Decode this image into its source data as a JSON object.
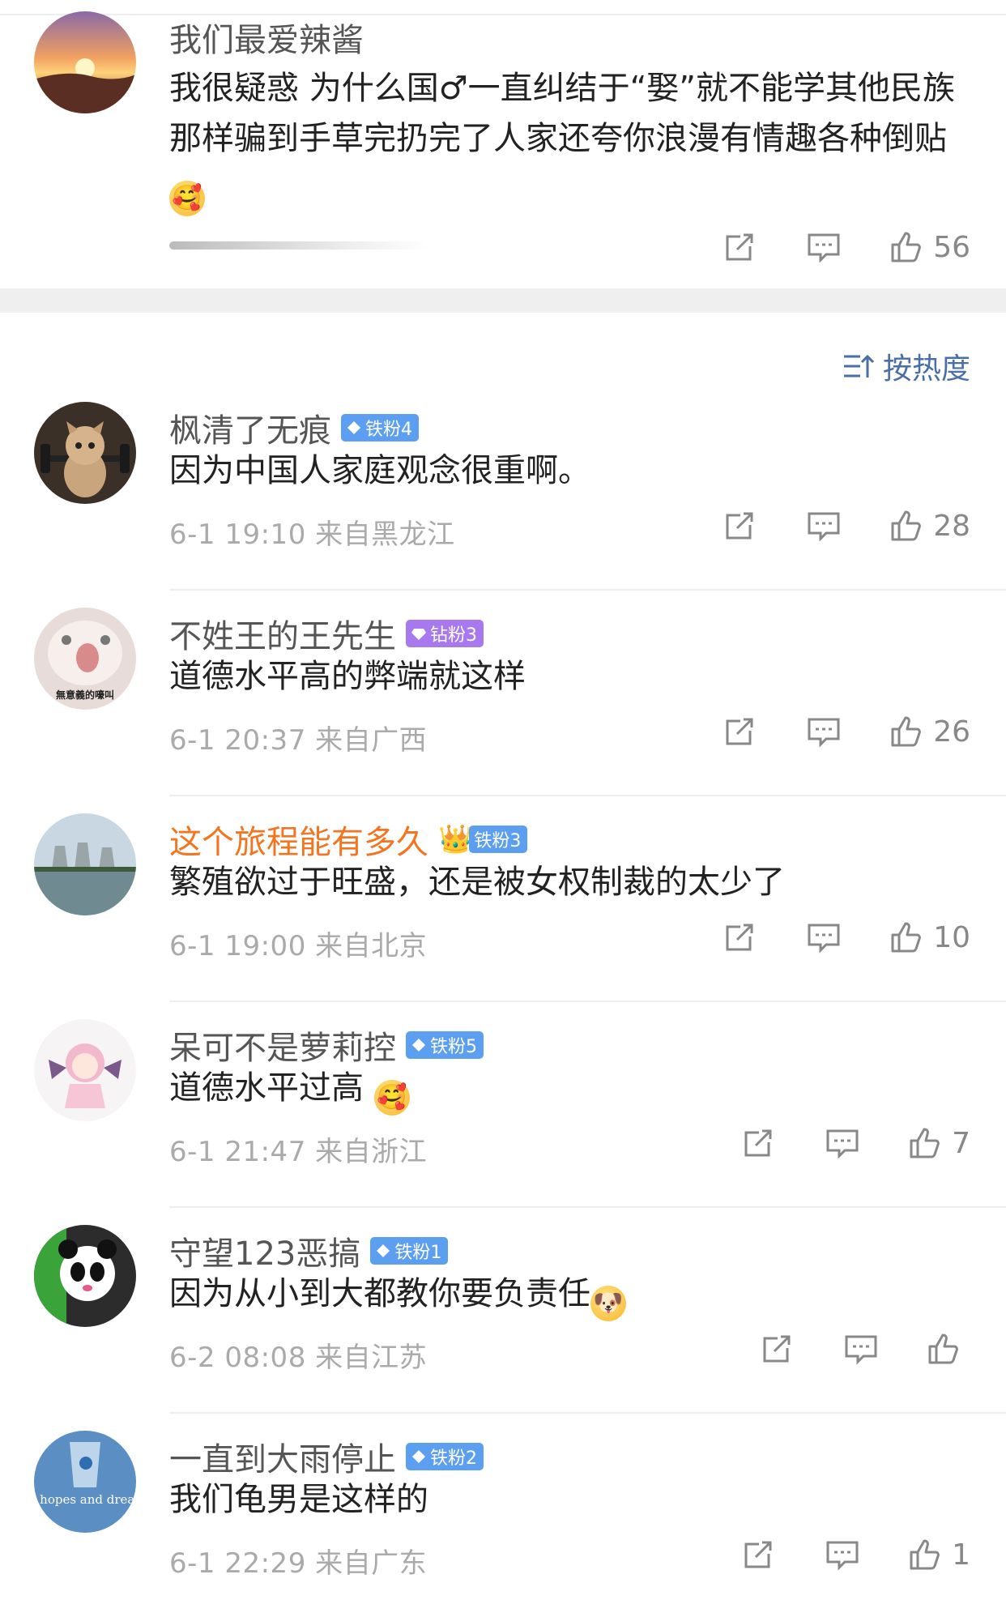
{
  "top_comment": {
    "username": "我们最爱辣酱",
    "text": "我很疑惑 为什么国♂一直纠结于“娶”就不能学其他民族那样骗到手草完扔完了人家还夸你浪漫有情趣各种倒贴",
    "emoji": "🥰",
    "likes": "56",
    "avatar_icon": "sunset-avatar"
  },
  "sort": {
    "label": "按热度"
  },
  "colors": {
    "accent_blue": "#4a6ea8",
    "name_orange": "#f47420",
    "badge_blue": "#5c9ff0",
    "badge_purple": "#a879ee"
  },
  "comments": [
    {
      "username": "枫清了无痕",
      "badge": "铁粉4",
      "badge_type": "blue",
      "text": "因为中国人家庭观念很重啊。",
      "time": "6-1 19:10",
      "location": "来自黑龙江",
      "likes": "28",
      "avatar_icon": "cat-avatar"
    },
    {
      "username": "不姓王的王先生",
      "badge": "钻粉3",
      "badge_type": "purple",
      "text": "道德水平高的弊端就这样",
      "time": "6-1 20:37",
      "location": "来自广西",
      "likes": "26",
      "avatar_icon": "blurry-pet-avatar",
      "avatar_caption": "無意義的嚎叫"
    },
    {
      "username": "这个旅程能有多久",
      "badge": "铁粉3",
      "badge_type": "blue",
      "crown": "👑",
      "text": "繁殖欲过于旺盛，还是被女权制裁的太少了",
      "time": "6-1 19:00",
      "location": "来自北京",
      "likes": "10",
      "avatar_icon": "factory-avatar"
    },
    {
      "username": "呆可不是萝莉控",
      "badge": "铁粉5",
      "badge_type": "blue",
      "text": "道德水平过高",
      "emoji": "🥰",
      "time": "6-1 21:47",
      "location": "来自浙江",
      "likes": "7",
      "avatar_icon": "anime-girl-avatar"
    },
    {
      "username": "守望123恶搞",
      "badge": "铁粉1",
      "badge_type": "blue",
      "text": "因为从小到大都教你要负责任",
      "emoji": "🐶",
      "time": "6-2 08:08",
      "location": "来自江苏",
      "likes": "",
      "avatar_icon": "panda-avatar"
    },
    {
      "username": "一直到大雨停止",
      "badge": "铁粉2",
      "badge_type": "blue",
      "text": "我们龟男是这样的",
      "time": "6-1 22:29",
      "location": "来自广东",
      "likes": "1",
      "avatar_icon": "glass-avatar",
      "avatar_caption": "my hopes and dreams"
    }
  ]
}
